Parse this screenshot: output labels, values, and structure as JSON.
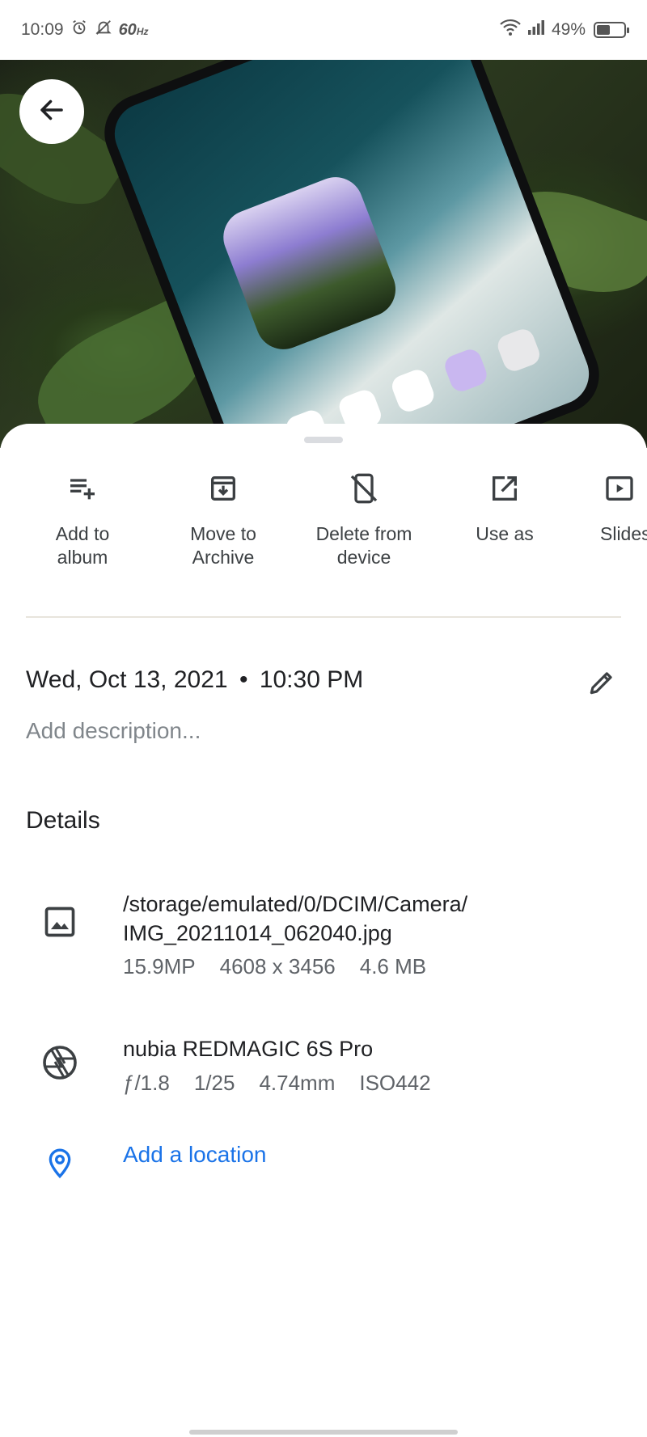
{
  "status_bar": {
    "time": "10:09",
    "refresh_rate": "60",
    "refresh_unit": "Hz",
    "battery": "49%",
    "battery_level": 0.49,
    "icons": [
      "alarm-icon",
      "mute-icon",
      "wifi-icon",
      "signal-icon",
      "battery-icon"
    ]
  },
  "photo": {
    "back_icon": "arrow-left-icon"
  },
  "actions": [
    {
      "label": "Add to\nalbum",
      "icon": "playlist-add-icon"
    },
    {
      "label": "Move to\nArchive",
      "icon": "archive-icon"
    },
    {
      "label": "Delete from\ndevice",
      "icon": "phone-delete-icon"
    },
    {
      "label": "Use as",
      "icon": "open-in-new-icon"
    },
    {
      "label": "Slides",
      "icon": "slideshow-icon"
    }
  ],
  "info": {
    "date": "Wed, Oct 13, 2021",
    "separator": "•",
    "time": "10:30 PM",
    "description_placeholder": "Add description..."
  },
  "details": {
    "title": "Details",
    "file": {
      "path": "/storage/emulated/0/DCIM/Camera/\nIMG_20211014_062040.jpg",
      "megapixels": "15.9MP",
      "resolution": "4608 x 3456",
      "size": "4.6 MB"
    },
    "camera": {
      "name": "nubia REDMAGIC 6S Pro",
      "aperture": "ƒ/1.8",
      "shutter": "1/25",
      "focal_length": "4.74mm",
      "iso": "ISO442"
    },
    "location_label": "Add a location"
  },
  "colors": {
    "accent": "#1a73e8",
    "text_primary": "#202124",
    "text_secondary": "#5f6368",
    "placeholder": "#80868b"
  }
}
